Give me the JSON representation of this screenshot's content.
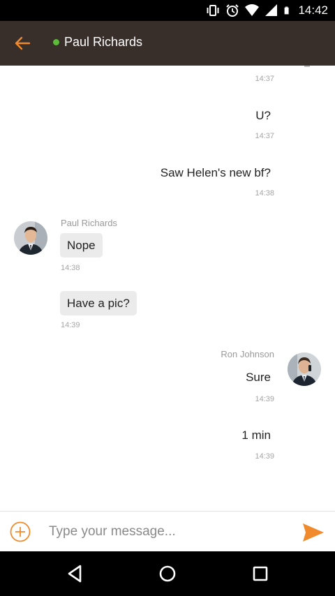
{
  "status_bar": {
    "time": "14:42"
  },
  "header": {
    "contact_name": "Paul Richards",
    "online_color": "#5dbb3a"
  },
  "messages": [
    {
      "text": "",
      "time": "14:37"
    },
    {
      "text": "U?",
      "time": "14:37"
    },
    {
      "text": "Saw Helen's new bf?",
      "time": "14:38"
    },
    {
      "sender": "Paul Richards",
      "text": "Nope",
      "time": "14:38"
    },
    {
      "text": "Have a pic?",
      "time": "14:39"
    },
    {
      "sender": "Ron Johnson",
      "text": "Sure",
      "time": "14:39"
    },
    {
      "text": "1 min",
      "time": "14:39"
    }
  ],
  "composer": {
    "placeholder": "Type your message..."
  },
  "colors": {
    "accent": "#f08a2c",
    "appbar": "#382e2a",
    "bubble": "#ebebeb"
  }
}
